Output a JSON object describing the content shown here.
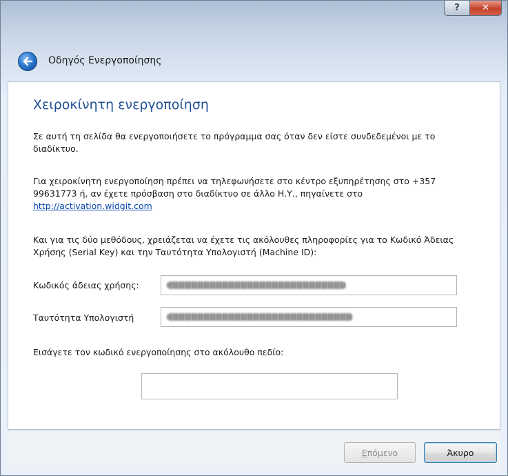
{
  "window": {
    "help_glyph": "?",
    "close_glyph": "✕"
  },
  "header": {
    "title": "Οδηγός Ενεργοποίησης"
  },
  "page": {
    "heading": "Χειροκίνητη ενεργοποίηση",
    "intro": "Σε αυτή τη σελίδα θα ενεργοποιήσετε το πρόγραμμα σας όταν δεν είστε συνδεδεμένοι με το διαδίκτυο.",
    "phone_text": "Για χειροκίνητη ενεργοποίηση πρέπει να τηλεφωνήσετε στο κέντρο εξυπηρέτησης στο +357 99631773 ή, αν έχετε πρόσβαση στο διαδίκτυο σε άλλο Η.Υ., πηγαίνετε στο",
    "link": "http://activation.widgit.com",
    "methods_text": "Και για τις δύο μεθόδους, χρειάζεται να έχετε τις ακόλουθες πληροφορίες για το Κωδικό Άδειας Χρήσης (Serial Key) και την Ταυτότητα Υπολογιστή (Machine ID):",
    "serial_label": "Κωδικός άδειας χρήσης:",
    "machine_label": "Ταυτότητα Υπολογιστή",
    "code_prompt": "Εισάγετε τον κωδικό ενεργοποίησης στο ακόλουθο πεδίο:",
    "code_value": ""
  },
  "footer": {
    "next_label_underlined": "Ε",
    "next_label_rest": "πόμενο",
    "cancel_label": "Άκυρο"
  },
  "colors": {
    "heading": "#1e4f94",
    "link": "#0645ad"
  }
}
